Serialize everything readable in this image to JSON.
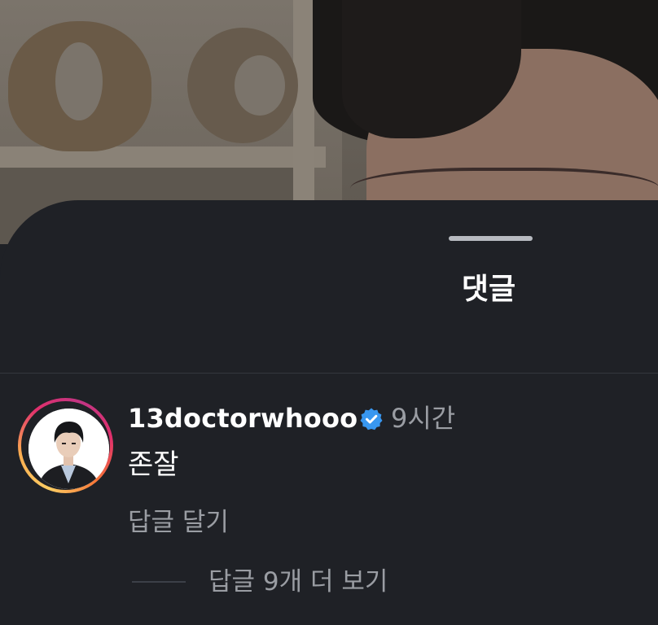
{
  "sheet": {
    "title": "댓글"
  },
  "comment": {
    "username": "13doctorwhooo",
    "verified": true,
    "time": "9시간",
    "text": "존잘",
    "reply_label": "답글 달기",
    "view_replies_label": "답글 9개 더 보기"
  },
  "colors": {
    "background": "#1f2126",
    "verified_badge": "#3897f0",
    "secondary_text": "#9a9da3"
  },
  "icons": {
    "verified": "verified-badge-icon",
    "avatar": "profile-avatar"
  }
}
